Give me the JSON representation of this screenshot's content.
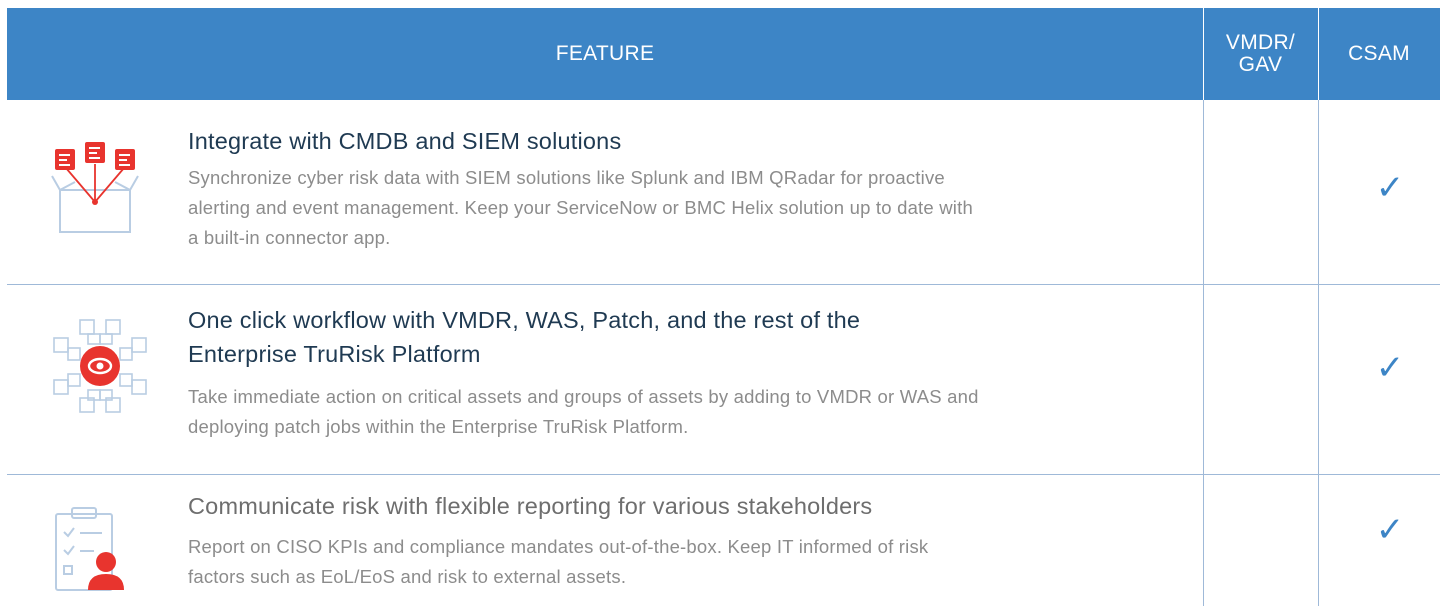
{
  "header": {
    "feature": "FEATURE",
    "vmdr_gav": "VMDR/\nGAV",
    "csam": "CSAM"
  },
  "rows": [
    {
      "title": "Integrate with CMDB and SIEM solutions",
      "description": "Synchronize cyber risk data with SIEM solutions like Splunk and IBM QRadar for proactive alerting and event management. Keep your ServiceNow or BMC Helix solution up to date with a built-in connector app.",
      "icon": "integration-box-icon",
      "vmdr_gav": "",
      "csam": "✓"
    },
    {
      "title": "One click workflow with VMDR, WAS, Patch, and the rest of the Enterprise TruRisk Platform",
      "description": "Take immediate action on critical assets and groups of assets by adding to VMDR or WAS and deploying patch jobs within the Enterprise TruRisk Platform.",
      "icon": "eye-network-icon",
      "vmdr_gav": "",
      "csam": "✓"
    },
    {
      "title": "Communicate risk with flexible reporting for various stakeholders",
      "description": "Report on CISO KPIs and compliance mandates out-of-the-box. Keep IT informed of risk factors such as EoL/EoS and risk to external assets.",
      "icon": "report-clipboard-icon",
      "vmdr_gav": "",
      "csam": "✓"
    }
  ],
  "colors": {
    "header_bg": "#3d85c6",
    "accent_red": "#e8342e",
    "check_blue": "#3d85c6"
  }
}
